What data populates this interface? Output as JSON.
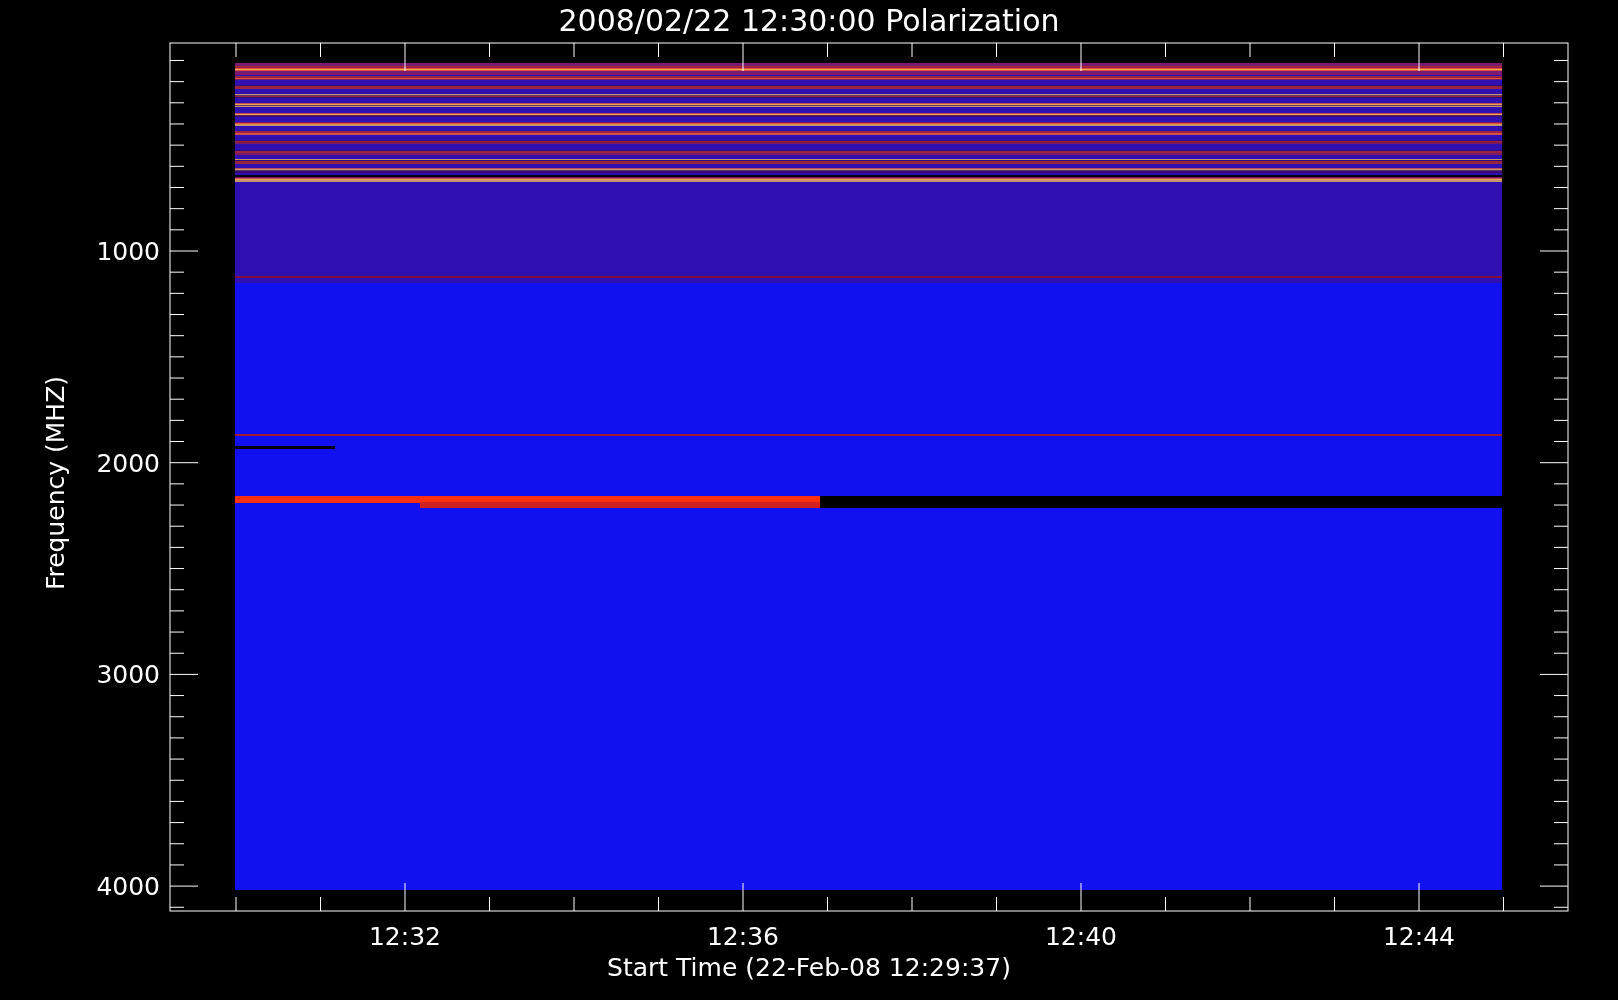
{
  "plot": {
    "title": "2008/02/22 12:30:00 Polarization",
    "ylabel": "Frequency (MHZ)",
    "xlabel": "Start Time (22-Feb-08 12:29:37)",
    "yticks": [
      "1000",
      "2000",
      "3000",
      "4000"
    ],
    "xticks": [
      "12:32",
      "12:36",
      "12:40",
      "12:44"
    ]
  }
}
